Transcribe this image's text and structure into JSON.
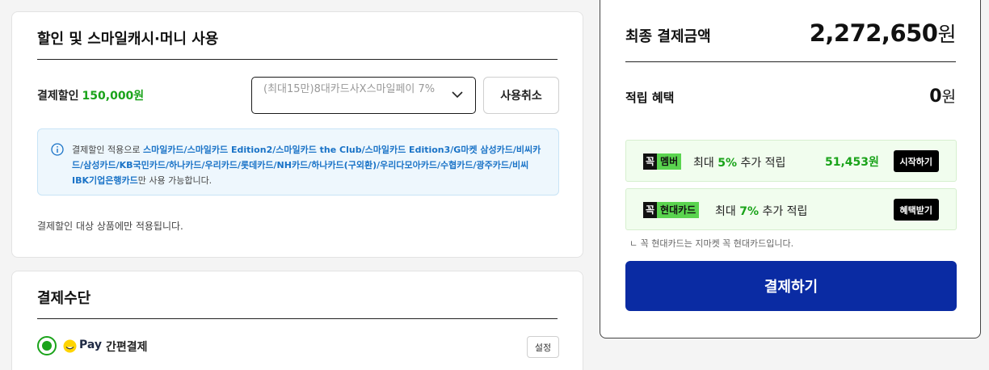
{
  "discount": {
    "title": "할인 및 스마일캐시·머니 사용",
    "label": "결제할인",
    "amount": "150,000원",
    "select_value": "(최대15만)8대카드사X스마일페이 7%",
    "cancel_label": "사용취소",
    "info_prefix": "결제할인 적용으로 ",
    "info_cards": "스마일카드/스마일카드 Edition2/스마일카드 the Club/스마일카드 Edition3/G마켓 삼성카드/비씨카드/삼성카드/KB국민카드/하나카드/우리카드/롯데카드/NH카드/하나카드(구외환)/우리다모아카드/수협카드/광주카드/비씨 IBK기업은행카드",
    "info_suffix": "만 사용 가능합니다.",
    "note": "결제할인 대상 상품에만 적용됩니다."
  },
  "payment": {
    "title": "결제수단",
    "pay_word": "Pay",
    "method_label": "간편결제",
    "setting_label": "설정"
  },
  "summary": {
    "total_label": "최종 결제금액",
    "total_amount": "2,272,650",
    "total_unit": "원",
    "reward_label": "적립 혜택",
    "reward_amount": "0",
    "reward_unit": "원",
    "promos": [
      {
        "tag_k": "꼭",
        "tag_name": "멤버",
        "text_prefix": "최대 ",
        "text_rate": "5%",
        "text_suffix": " 추가 적립",
        "amount": "51,453원",
        "button": "시작하기"
      },
      {
        "tag_k": "꼭",
        "tag_name": "현대카드",
        "text_prefix": "최대 ",
        "text_rate": "7%",
        "text_suffix": " 추가 적립",
        "button": "혜택받기"
      }
    ],
    "card_note": "ㄴ 꼭 현대카드는 지마켓 꼭 현대카드입니다.",
    "pay_button": "결제하기"
  },
  "colors": {
    "accent_green": "#1aa31a",
    "pay_blue": "#0a2ba3",
    "info_blue": "#1a73c7"
  }
}
